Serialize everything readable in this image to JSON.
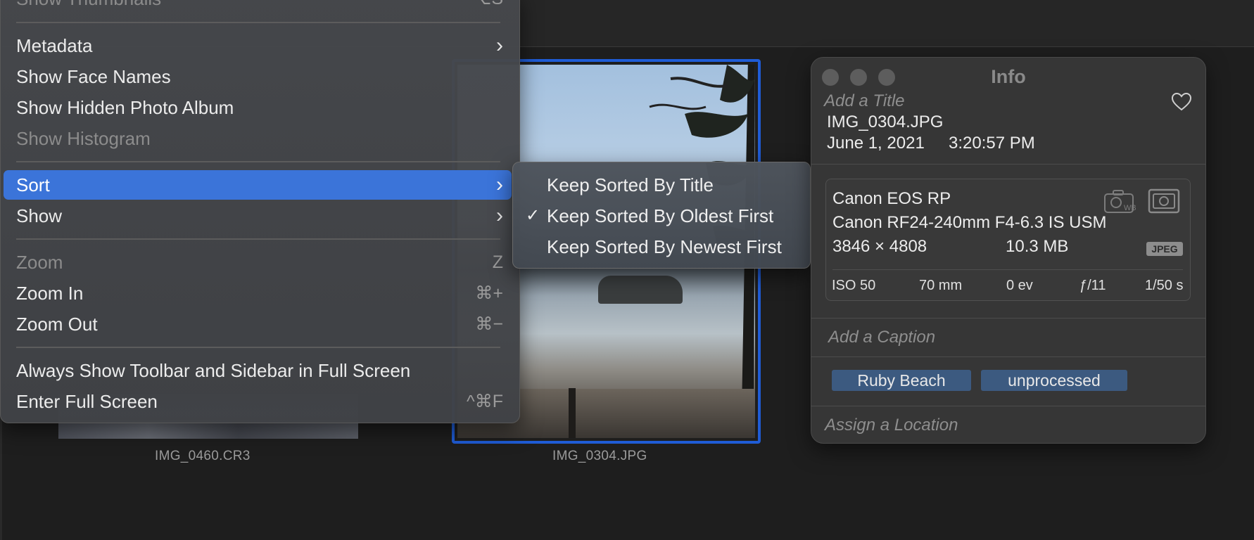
{
  "menu": {
    "items": [
      {
        "label": "Show Thumbnails",
        "shortcut": "⌥S",
        "disabled": true
      },
      {
        "label": "Metadata",
        "submenu": true
      },
      {
        "label": "Show Face Names"
      },
      {
        "label": "Show Hidden Photo Album"
      },
      {
        "label": "Show Histogram",
        "disabled": true
      },
      {
        "label": "Sort",
        "submenu": true,
        "highlighted": true
      },
      {
        "label": "Show",
        "submenu": true
      },
      {
        "label": "Zoom",
        "shortcut": "Z",
        "disabled": true
      },
      {
        "label": "Zoom In",
        "shortcut": "⌘+"
      },
      {
        "label": "Zoom Out",
        "shortcut": "⌘−"
      },
      {
        "label": "Always Show Toolbar and Sidebar in Full Screen"
      },
      {
        "label": "Enter Full Screen",
        "shortcut": "^⌘F"
      }
    ]
  },
  "sort_submenu": {
    "items": [
      {
        "label": "Keep Sorted By Title",
        "checked": false
      },
      {
        "label": "Keep Sorted By Oldest First",
        "checked": true
      },
      {
        "label": "Keep Sorted By Newest First",
        "checked": false
      }
    ],
    "check_glyph": "✓"
  },
  "thumbnails": [
    {
      "filename": "IMG_0460.CR3",
      "selected": false
    },
    {
      "filename": "IMG_0304.JPG",
      "selected": true
    }
  ],
  "info": {
    "window_title": "Info",
    "title_placeholder": "Add a Title",
    "filename": "IMG_0304.JPG",
    "date": "June 1, 2021",
    "time": "3:20:57 PM",
    "camera": "Canon EOS RP",
    "lens": "Canon RF24-240mm F4-6.3 IS USM",
    "dimensions": "3846 × 4808",
    "file_size": "10.3 MB",
    "format_badge": "JPEG",
    "wb_label": "WB",
    "exif": {
      "iso": "ISO 50",
      "focal_length": "70 mm",
      "exposure_bias": "0 ev",
      "aperture": "ƒ/11",
      "shutter": "1/50 s"
    },
    "caption_placeholder": "Add a Caption",
    "keywords": [
      "Ruby Beach",
      "unprocessed"
    ],
    "location_placeholder": "Assign a Location",
    "favorite_icon": "heart-icon"
  },
  "colors": {
    "selection_blue": "#3b74d9",
    "thumbnail_border": "#1f5cd6",
    "keyword_bg": "#3c5a80"
  }
}
